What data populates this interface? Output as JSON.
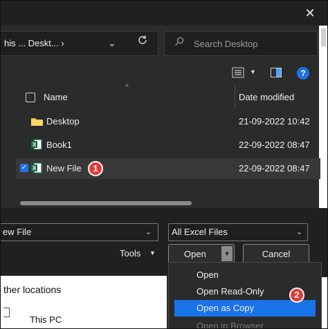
{
  "window": {
    "close_icon": "close-icon"
  },
  "address": {
    "breadcrumb": "his ... Deskt... ›",
    "chevron": "⌄",
    "refresh_icon": "refresh-icon"
  },
  "search": {
    "placeholder": "Search Desktop"
  },
  "toolbar": {
    "view_icon": "view-menu-icon",
    "pane_icon": "preview-pane-icon",
    "help_label": "?"
  },
  "columns": {
    "name": "Name",
    "date": "Date modified"
  },
  "files": [
    {
      "name": "Desktop",
      "date": "21-09-2022 10:42",
      "type": "folder",
      "selected": false
    },
    {
      "name": "Book1",
      "date": "22-09-2022 08:47",
      "type": "excel",
      "selected": false
    },
    {
      "name": "New File",
      "date": "22-09-2022 08:47",
      "type": "excel",
      "selected": true
    }
  ],
  "annotations": {
    "step1": "1",
    "step2": "2"
  },
  "bottom": {
    "filename_value": "ew File",
    "filetype_value": "All Excel Files",
    "tools_label": "Tools",
    "open_label": "Open",
    "cancel_label": "Cancel"
  },
  "open_menu": {
    "items": [
      "Open",
      "Open Read-Only",
      "Open as Copy",
      "Open in Browser"
    ],
    "highlighted": "Open as Copy"
  },
  "nav": {
    "other_locations": "ther locations",
    "this_pc": "This PC"
  },
  "colors": {
    "accent": "#1a73e8",
    "badge": "#e53935",
    "excel_green": "#1d6f42",
    "folder_yellow": "#f5c242"
  }
}
